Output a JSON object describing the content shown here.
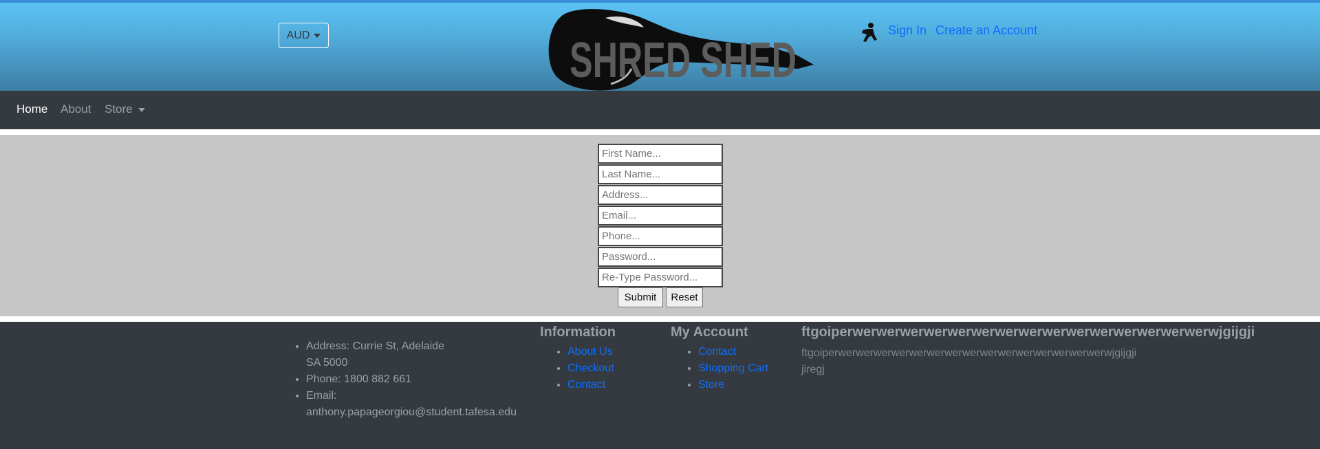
{
  "header": {
    "currency": "AUD",
    "logo_text": "SHRED SHED",
    "sign_in": "Sign In",
    "create_account": "Create an Account"
  },
  "navbar": {
    "home": "Home",
    "about": "About",
    "store": "Store"
  },
  "form": {
    "first_name_placeholder": "First Name...",
    "last_name_placeholder": "Last Name...",
    "address_placeholder": "Address...",
    "email_placeholder": "Email...",
    "phone_placeholder": "Phone...",
    "password_placeholder": "Password...",
    "retype_password_placeholder": "Re-Type Password...",
    "submit": "Submit",
    "reset": "Reset"
  },
  "footer": {
    "contact": {
      "address_line1": "Address: Currie St, Adelaide",
      "address_line2": "SA 5000",
      "phone": "Phone: 1800 882 661",
      "email_label": "Email:",
      "email_value": "anthony.papageorgiou@student.tafesa.edu"
    },
    "information": {
      "heading": "Information",
      "links": [
        "About Us",
        "Checkout",
        "Contact"
      ]
    },
    "my_account": {
      "heading": "My Account",
      "links": [
        "Contact",
        "Shopping Cart",
        "Store"
      ]
    },
    "extra": {
      "heading": "ftgoiperwerwerwerwerwerwerwerwerwerwerwerwerwerwerwerwjgijgji",
      "line1": "ftgoiperwerwerwerwerwerwerwerwerwerwerwerwerwerwerwerwjgijgji",
      "line2": "jiregj"
    }
  },
  "colors": {
    "link": "#0d6efd",
    "navbar_bg": "#343a40",
    "form_bg": "#c6c6c6"
  }
}
